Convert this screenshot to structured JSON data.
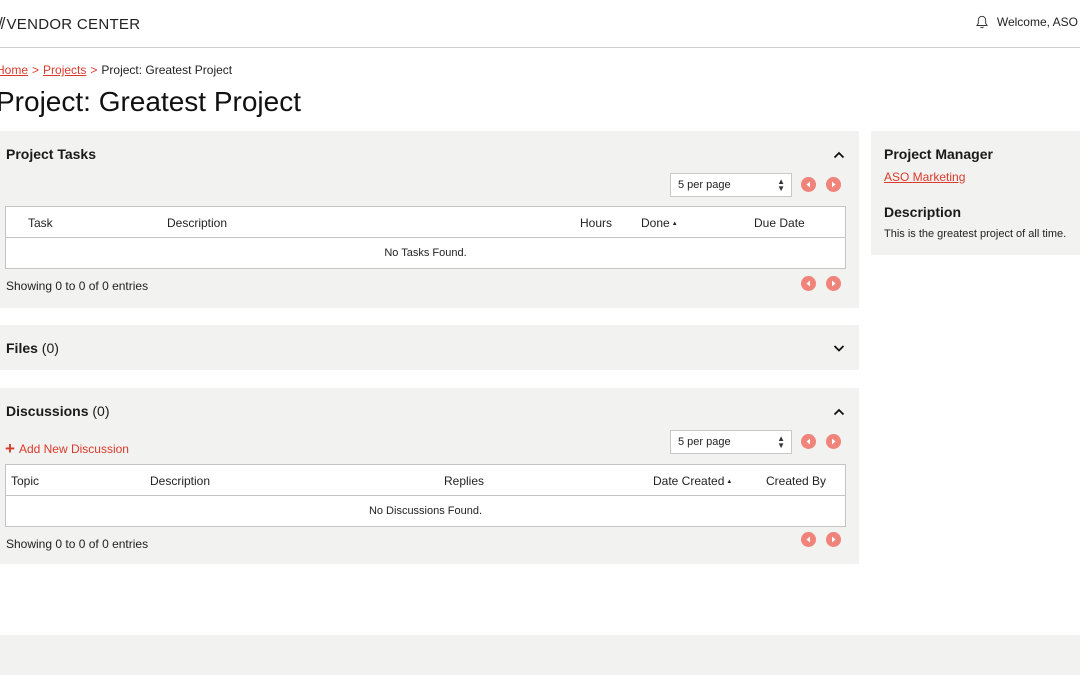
{
  "header": {
    "brand": "VENDOR CENTER",
    "welcome": "Welcome, ASO"
  },
  "breadcrumb": {
    "home": "Home",
    "projects": "Projects",
    "current": "Project: Greatest Project",
    "separator": ">"
  },
  "page_title": "Project: Greatest Project",
  "tasks": {
    "title": "Project Tasks",
    "per_page": "5 per page",
    "columns": [
      "Task",
      "Description",
      "Hours",
      "Done",
      "Due Date"
    ],
    "empty": "No Tasks Found.",
    "showing": "Showing 0 to 0 of 0 entries"
  },
  "files": {
    "title": "Files",
    "count": "(0)"
  },
  "discussions": {
    "title": "Discussions",
    "count": "(0)",
    "add_label": "Add New Discussion",
    "per_page": "5 per page",
    "columns": [
      "Topic",
      "Description",
      "Replies",
      "Date Created",
      "Created By"
    ],
    "empty": "No Discussions Found.",
    "showing": "Showing 0 to 0 of 0 entries"
  },
  "sidebar": {
    "manager_heading": "Project Manager",
    "manager_name": "ASO Marketing",
    "description_heading": "Description",
    "description": "This is the greatest project of all time."
  },
  "colors": {
    "accent": "#d93a2b",
    "nav_button": "#f0837a",
    "panel_bg": "#f2f2f1"
  },
  "icons": [
    "bell-icon",
    "chevron-up-icon",
    "chevron-down-icon",
    "previous-page-icon",
    "next-page-icon",
    "plus-icon",
    "select-arrows-icon"
  ]
}
